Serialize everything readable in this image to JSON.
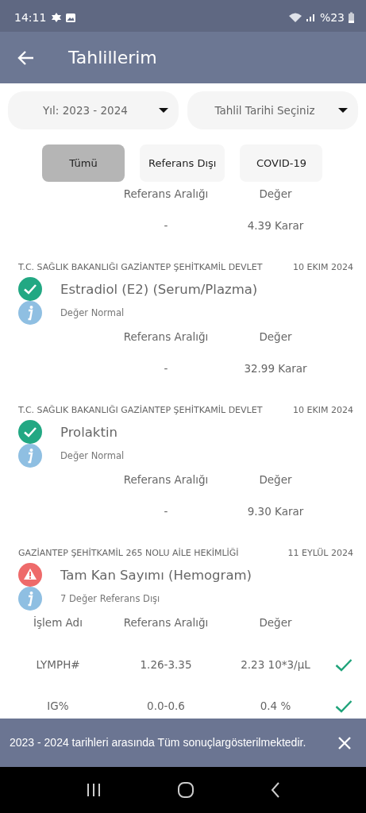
{
  "status_bar": {
    "time": "14:11",
    "battery": "%23"
  },
  "app_bar": {
    "title": "Tahlillerim"
  },
  "filters": [
    {
      "value": "Yıl: 2023 - 2024"
    },
    {
      "value": "Tahlil Tarihi Seçiniz"
    }
  ],
  "tabs": [
    {
      "label": "Tümü",
      "selected": true
    },
    {
      "label": "Referans Dışı",
      "selected": false
    },
    {
      "label": "COVID-19",
      "selected": false
    }
  ],
  "results": [
    {
      "columns": {
        "reference": "Referans Aralığı",
        "value": "Değer"
      },
      "rows": [
        {
          "reference": "-",
          "value": "4.39 Karar"
        }
      ]
    },
    {
      "facility": "T.C. SAĞLIK BAKANLIĞI GAZİANTEP ŞEHİTKAMİL DEVLET",
      "date": "10 EKIM 2024",
      "kind": "normal",
      "title": "Estradiol (E2) (Serum/Plazma)",
      "summary": "Değer Normal",
      "columns": {
        "reference": "Referans Aralığı",
        "value": "Değer"
      },
      "rows": [
        {
          "reference": "-",
          "value": "32.99 Karar"
        }
      ]
    },
    {
      "facility": "T.C. SAĞLIK BAKANLIĞI GAZİANTEP ŞEHİTKAMİL DEVLET",
      "date": "10 EKIM 2024",
      "kind": "normal",
      "title": "Prolaktin",
      "summary": "Değer Normal",
      "columns": {
        "reference": "Referans Aralığı",
        "value": "Değer"
      },
      "rows": [
        {
          "reference": "-",
          "value": "9.30 Karar"
        }
      ]
    },
    {
      "facility": "GAZİANTEP ŞEHİTKAMİL 265 NOLU AİLE HEKİMLİĞİ",
      "date": "11 EYLÜL 2024",
      "kind": "warning",
      "title": "Tam Kan Sayımı (Hemogram)",
      "summary": "7 Değer Referans Dışı",
      "columns": {
        "name": "İşlem Adı",
        "reference": "Referans Aralığı",
        "value": "Değer"
      },
      "rows": [
        {
          "name": "LYMPH#",
          "reference": "1.26-3.35",
          "value": "2.23 10*3/µL",
          "ok": true
        },
        {
          "name": "IG%",
          "reference": "0.0-0.6",
          "value": "0.4 %",
          "ok": true
        }
      ]
    }
  ],
  "snackbar": {
    "message": "2023 - 2024 tarihleri arasında Tüm sonuçlargösterilmektedir."
  }
}
